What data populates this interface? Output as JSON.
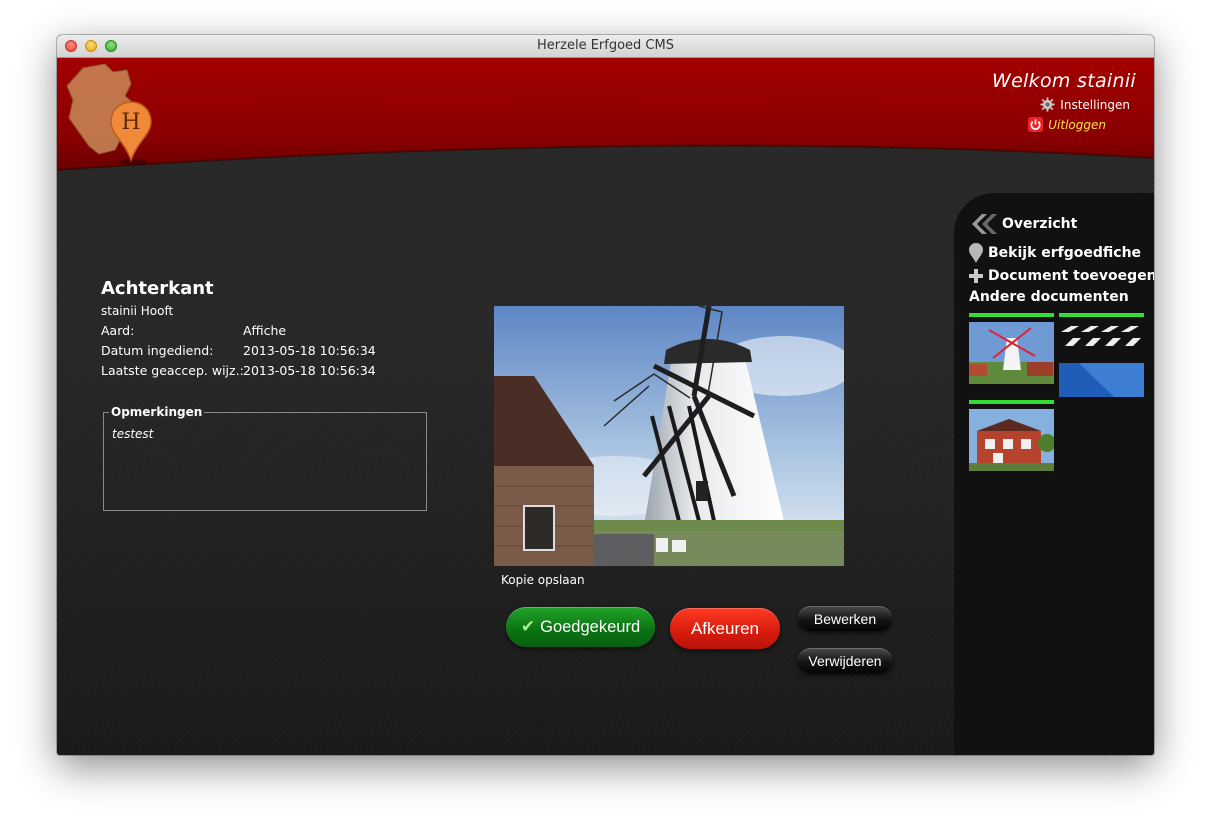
{
  "window": {
    "title": "Herzele Erfgoed CMS"
  },
  "header": {
    "logo_letter": "H",
    "welcome": "Welkom stainii",
    "settings_label": "Instellingen",
    "logout_label": "Uitloggen"
  },
  "document": {
    "title": "Achterkant",
    "author": "stainii Hooft",
    "fields": [
      {
        "label": "Aard:",
        "value": "Affiche"
      },
      {
        "label": "Datum ingediend:",
        "value": "2013-05-18 10:56:34"
      },
      {
        "label": "Laatste geaccep. wijz.:",
        "value": "2013-05-18 10:56:34"
      }
    ],
    "remarks_label": "Opmerkingen",
    "remarks_text": "testest"
  },
  "image": {
    "save_copy_label": "Kopie opslaan"
  },
  "actions": {
    "approve": "Goedgekeurd",
    "reject": "Afkeuren",
    "edit": "Bewerken",
    "delete": "Verwijderen"
  },
  "sidebar": {
    "overview": "Overzicht",
    "view_heritage": "Bekijk erfgoedfiche",
    "add_document": "Document toevoegen",
    "other_documents": "Andere documenten",
    "thumbnails": [
      {
        "type": "photo",
        "subject": "windmill"
      },
      {
        "type": "video",
        "subject": "clapperboard"
      },
      {
        "type": "photo",
        "subject": "house"
      }
    ]
  },
  "colors": {
    "header_red": "#8c0000",
    "approve_green": "#0a7212",
    "reject_red": "#d61b0c",
    "thumb_bar": "#33dd33"
  }
}
